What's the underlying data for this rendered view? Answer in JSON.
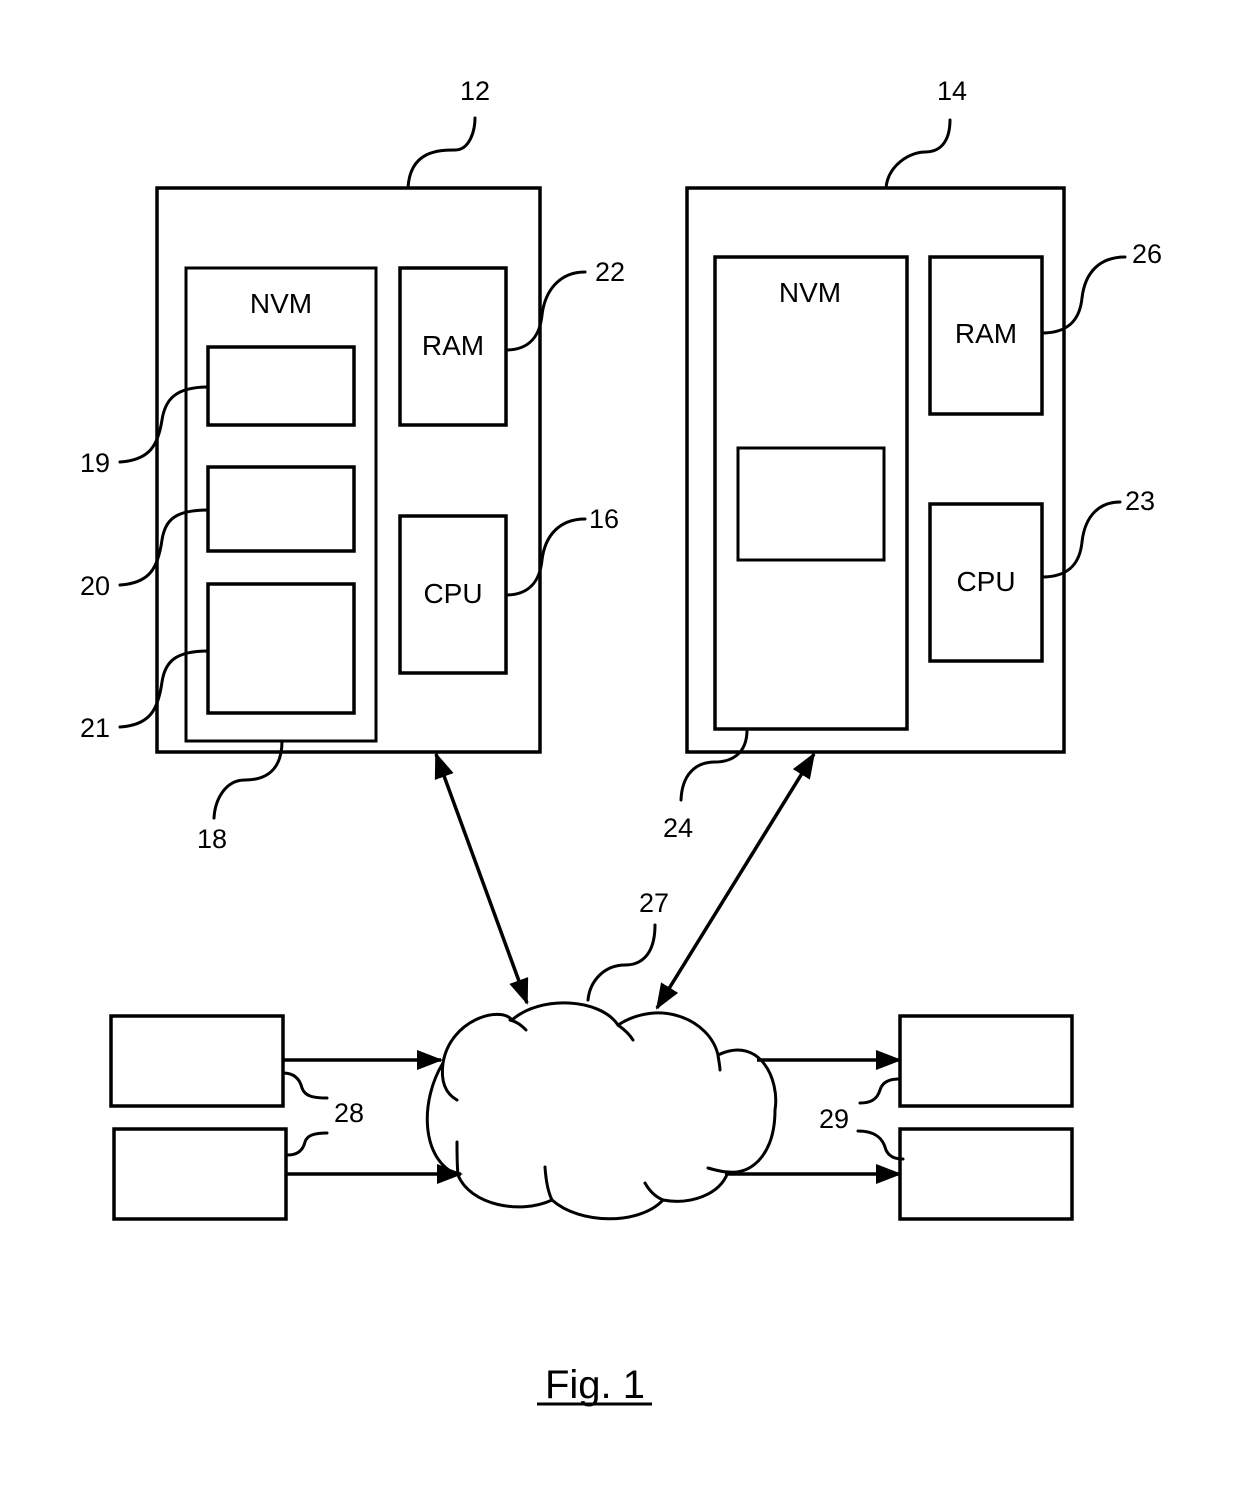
{
  "figure": {
    "caption": "Fig. 1"
  },
  "device_left": {
    "ref": "12",
    "nvm": {
      "label": "NVM",
      "ref": "18"
    },
    "nvm_blocks": [
      {
        "ref": "19"
      },
      {
        "ref": "20"
      },
      {
        "ref": "21"
      }
    ],
    "ram": {
      "label": "RAM",
      "ref": "22"
    },
    "cpu": {
      "label": "CPU",
      "ref": "16"
    }
  },
  "device_right": {
    "ref": "14",
    "nvm": {
      "label": "NVM",
      "ref": "24"
    },
    "ram": {
      "label": "RAM",
      "ref": "26"
    },
    "cpu": {
      "label": "CPU",
      "ref": "23"
    }
  },
  "network": {
    "ref": "27"
  },
  "sources": {
    "ref": "28"
  },
  "sinks": {
    "ref": "29"
  }
}
